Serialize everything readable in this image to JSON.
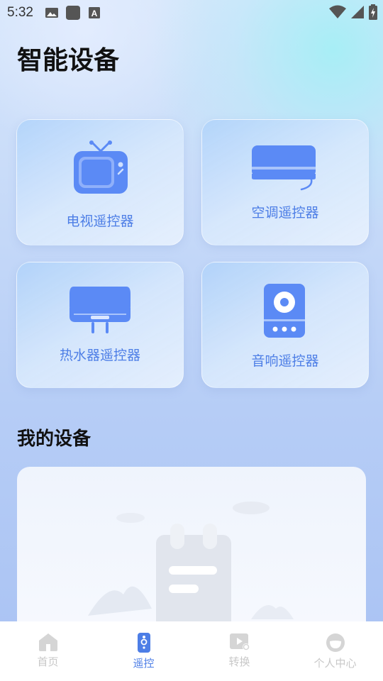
{
  "status_bar": {
    "time": "5:32",
    "left_icons": [
      "image-icon",
      "app-square-icon",
      "font-a-icon"
    ],
    "right_icons": [
      "wifi-icon",
      "cell-signal-icon",
      "battery-charging-icon"
    ]
  },
  "page": {
    "title": "智能设备",
    "section_title": "我的设备"
  },
  "remote_cards": [
    {
      "label": "电视遥控器",
      "icon": "tv-icon"
    },
    {
      "label": "空调遥控器",
      "icon": "air-conditioner-icon"
    },
    {
      "label": "热水器遥控器",
      "icon": "water-heater-icon"
    },
    {
      "label": "音响遥控器",
      "icon": "speaker-icon"
    }
  ],
  "my_devices": {
    "empty_state_icon": "empty-notepad-icon"
  },
  "bottom_nav": {
    "items": [
      {
        "label": "首页",
        "icon": "home-icon",
        "active": false
      },
      {
        "label": "遥控",
        "icon": "remote-icon",
        "active": true
      },
      {
        "label": "转换",
        "icon": "convert-icon",
        "active": false
      },
      {
        "label": "个人中心",
        "icon": "profile-icon",
        "active": false
      }
    ]
  },
  "colors": {
    "accent": "#4d7ee6",
    "icon_blue": "#5b8af5",
    "inactive": "#c8c8c8"
  }
}
